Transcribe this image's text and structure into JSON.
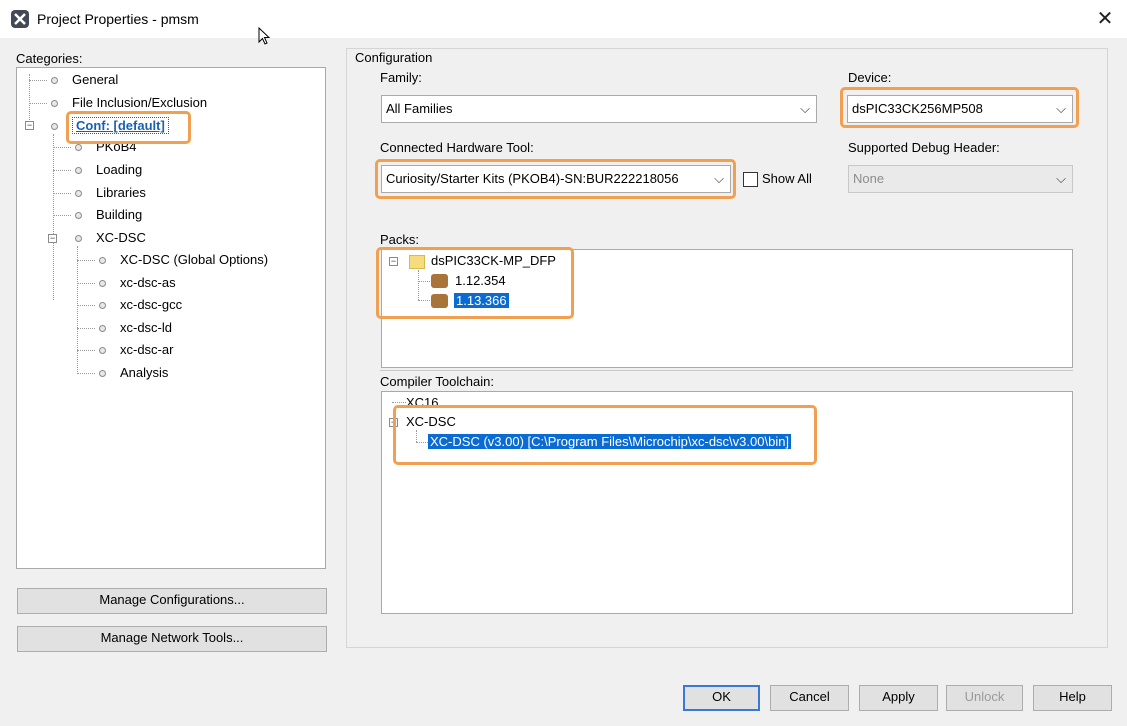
{
  "window": {
    "title": "Project Properties - pmsm",
    "close_glyph": "✕"
  },
  "left": {
    "categories_label": "Categories:",
    "tree": [
      {
        "label": "General"
      },
      {
        "label": "File Inclusion/Exclusion"
      },
      {
        "label": "Conf: [default]"
      },
      {
        "label": "PKoB4"
      },
      {
        "label": "Loading"
      },
      {
        "label": "Libraries"
      },
      {
        "label": "Building"
      },
      {
        "label": "XC-DSC"
      },
      {
        "label": "XC-DSC (Global Options)"
      },
      {
        "label": "xc-dsc-as"
      },
      {
        "label": "xc-dsc-gcc"
      },
      {
        "label": "xc-dsc-ld"
      },
      {
        "label": "xc-dsc-ar"
      },
      {
        "label": "Analysis"
      }
    ],
    "manage_configurations": "Manage Configurations...",
    "manage_network_tools": "Manage Network Tools..."
  },
  "config": {
    "group_title": "Configuration",
    "family_label": "Family:",
    "family_value": "All Families",
    "device_label": "Device:",
    "device_value": "dsPIC33CK256MP508",
    "hw_tool_label": "Connected Hardware Tool:",
    "hw_tool_value": "Curiosity/Starter Kits (PKOB4)-SN:BUR222218056",
    "show_all_label": "Show All",
    "debug_header_label": "Supported Debug Header:",
    "debug_header_value": "None",
    "packs_label": "Packs:",
    "pack_name": "dsPIC33CK-MP_DFP",
    "pack_versions": [
      "1.12.354",
      "1.13.366"
    ],
    "toolchain_label": "Compiler Toolchain:",
    "toolchains": [
      "XC16",
      "XC-DSC"
    ],
    "toolchain_selected": "XC-DSC (v3.00) [C:\\Program Files\\Microchip\\xc-dsc\\v3.00\\bin]"
  },
  "buttons": {
    "ok": "OK",
    "cancel": "Cancel",
    "apply": "Apply",
    "unlock": "Unlock",
    "help": "Help"
  },
  "icons": {
    "app": "app-icon",
    "close": "close-icon",
    "dropdown": "chevron-down-icon",
    "tree_node": "tree-node-dot-icon",
    "package": "package-icon",
    "folder": "folder-icon"
  },
  "colors": {
    "highlight": "#f0a050",
    "selection": "#0a6cd2",
    "link": "#1a5fb4"
  }
}
